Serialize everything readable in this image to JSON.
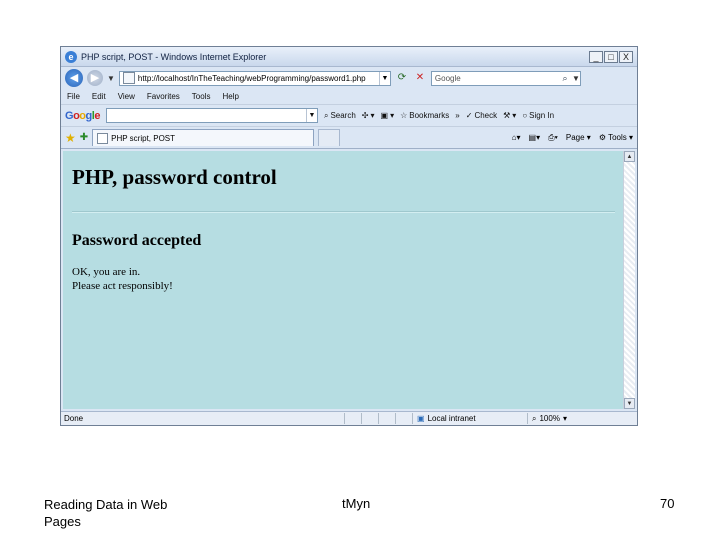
{
  "window": {
    "title": "PHP script, POST - Windows Internet Explorer",
    "buttons": [
      "_",
      "□",
      "X"
    ]
  },
  "address_bar": {
    "url": "http://localhost/InTheTeaching/webProgramming/password1.php",
    "search_placeholder": "Google"
  },
  "menu": [
    "File",
    "Edit",
    "View",
    "Favorites",
    "Tools",
    "Help"
  ],
  "google_toolbar": {
    "logo": "Google",
    "search_label": "Search",
    "bookmarks_label": "Bookmarks",
    "check_label": "Check",
    "sign_in_label": "Sign In"
  },
  "tab": {
    "label": "PHP script, POST"
  },
  "command_bar": {
    "page_label": "Page",
    "tools_label": "Tools"
  },
  "page": {
    "heading": "PHP, password control",
    "subheading": "Password accepted",
    "line1": "OK, you are in.",
    "line2": "Please act responsibly!",
    "background": "#b6dde2"
  },
  "status_bar": {
    "status": "Done",
    "zone": "Local intranet",
    "zoom": "100%"
  },
  "slide_footer": {
    "left": "Reading Data in Web Pages",
    "middle": "tMyn",
    "page_number": "70"
  }
}
